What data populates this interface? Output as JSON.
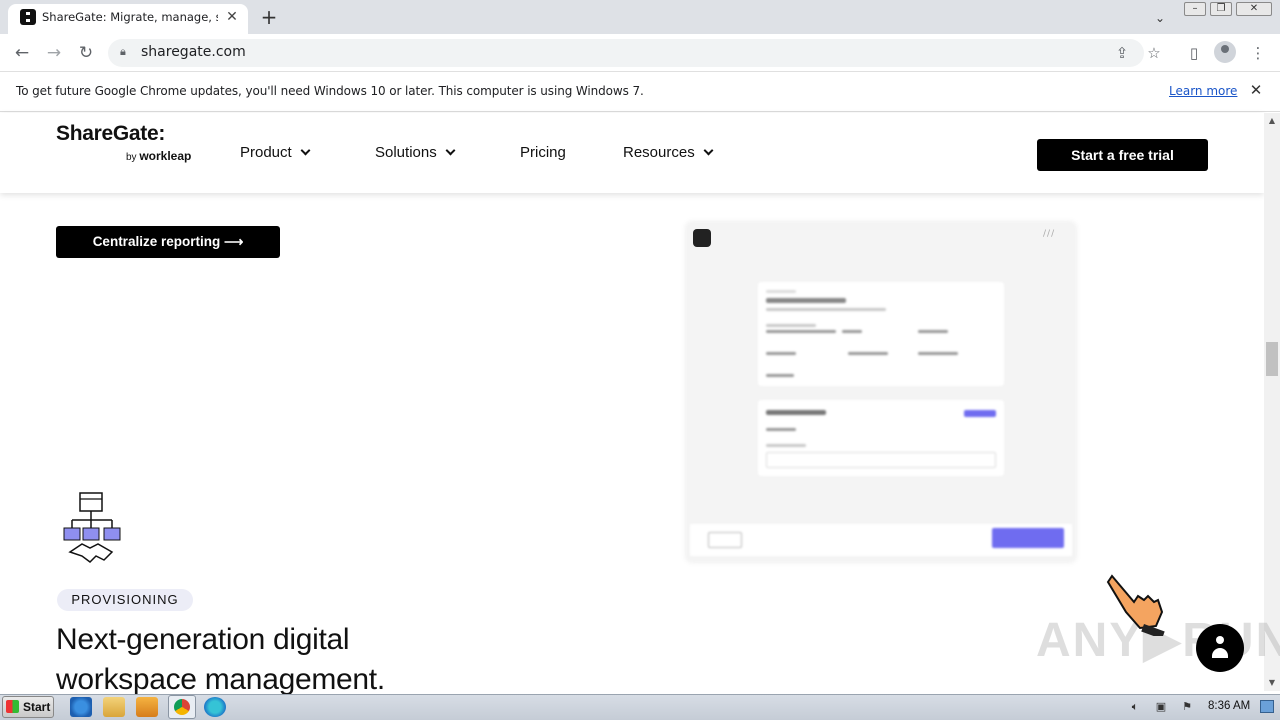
{
  "browser": {
    "tab_title": "ShareGate: Migrate, manage, secure",
    "tab_close": "✕",
    "new_tab": "+",
    "url": "sharegate.com",
    "window_controls": [
      "–",
      "❐",
      "✕"
    ]
  },
  "infobar": {
    "message": "To get future Google Chrome updates, you'll need Windows 10 or later. This computer is using Windows 7.",
    "link": "Learn more",
    "close": "✕"
  },
  "site": {
    "logo": "ShareGate:",
    "logo_by": "by",
    "logo_brand": "workleap",
    "nav": [
      {
        "label": "Product",
        "has_dropdown": true
      },
      {
        "label": "Solutions",
        "has_dropdown": true
      },
      {
        "label": "Pricing",
        "has_dropdown": false
      },
      {
        "label": "Resources",
        "has_dropdown": true
      }
    ],
    "cta": "Start a free trial"
  },
  "content": {
    "centralize_button": "Centralize reporting  ⟶",
    "badge": "PROVISIONING",
    "heading": "Next-generation digital workspace management."
  },
  "taskbar": {
    "start": "Start",
    "clock": "8:36 AM"
  },
  "colors": {
    "accent_purple": "#6f6cf0",
    "black": "#000000",
    "badge_bg": "#ecedf7",
    "link_blue": "#1a55c8"
  }
}
